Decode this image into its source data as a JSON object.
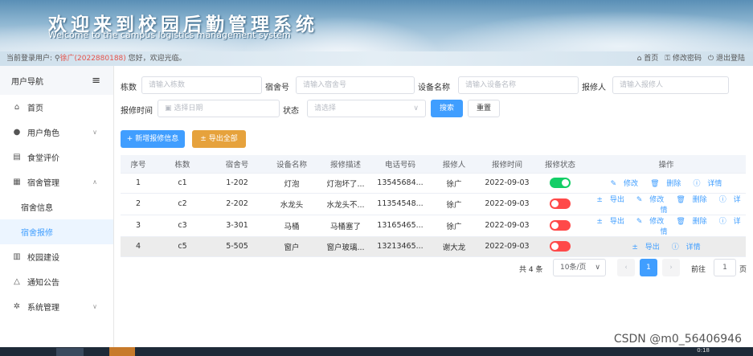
{
  "header": {
    "title_cn": "欢迎来到校园后勤管理系统",
    "title_en": "Welcome to the campus logistics management system"
  },
  "infobar": {
    "prefix": "当前登录用户: ",
    "user": "徐广(2022880188)",
    "greeting": " 您好，欢迎光临。",
    "links": [
      "首页",
      "修改密码",
      "退出登陆"
    ]
  },
  "sidebar": {
    "title": "用户导航",
    "items": [
      {
        "label": "首页",
        "icon": "home-icon"
      },
      {
        "label": "用户角色",
        "icon": "user-icon"
      },
      {
        "label": "食堂评价",
        "icon": "document-icon"
      },
      {
        "label": "宿舍管理",
        "icon": "building-icon"
      },
      {
        "label": "宿舍信息"
      },
      {
        "label": "宿舍报修"
      },
      {
        "label": "校园建设",
        "icon": "building-icon"
      },
      {
        "label": "通知公告",
        "icon": "bell-icon"
      },
      {
        "label": "系统管理",
        "icon": "gear-icon"
      }
    ]
  },
  "search": {
    "building_label": "栋数",
    "building_ph": "请输入栋数",
    "room_label": "宿舍号",
    "room_ph": "请输入宿舍号",
    "device_label": "设备名称",
    "device_ph": "请输入设备名称",
    "reporter_label": "报修人",
    "reporter_ph": "请输入报修人",
    "time_label": "报修时间",
    "time_ph": "选择日期",
    "status_label": "状态",
    "status_ph": "请选择",
    "search_btn": "搜索",
    "reset_btn": "重置"
  },
  "actions": {
    "add": "+ 新增报修信息",
    "export_all": "± 导出全部"
  },
  "table": {
    "headers": [
      "序号",
      "栋数",
      "宿舍号",
      "设备名称",
      "报修描述",
      "电话号码",
      "报修人",
      "报修时间",
      "报修状态",
      "操作"
    ],
    "rows": [
      {
        "no": "1",
        "building": "c1",
        "room": "1-202",
        "device": "灯泡",
        "desc": "灯泡坏了...",
        "phone": "13545684...",
        "reporter": "徐广",
        "time": "2022-09-03",
        "status": true,
        "ops": [
          "修改",
          "删除",
          "详情"
        ]
      },
      {
        "no": "2",
        "building": "c2",
        "room": "2-202",
        "device": "水龙头",
        "desc": "水龙头不...",
        "phone": "11354548...",
        "reporter": "徐广",
        "time": "2022-09-03",
        "status": false,
        "ops": [
          "导出",
          "修改",
          "删除",
          "详情"
        ]
      },
      {
        "no": "3",
        "building": "c3",
        "room": "3-301",
        "device": "马桶",
        "desc": "马桶塞了",
        "phone": "13165465...",
        "reporter": "徐广",
        "time": "2022-09-03",
        "status": false,
        "ops": [
          "导出",
          "修改",
          "删除",
          "详情"
        ]
      },
      {
        "no": "4",
        "building": "c5",
        "room": "5-505",
        "device": "窗户",
        "desc": "窗户玻璃...",
        "phone": "13213465...",
        "reporter": "谢大龙",
        "time": "2022-09-03",
        "status": false,
        "ops": [
          "导出",
          "详情"
        ]
      }
    ]
  },
  "pagination": {
    "total": "共 4 条",
    "size": "10条/页",
    "page": "1",
    "goto": "前往",
    "goto_val": "1",
    "page_unit": "页"
  },
  "watermark": "CSDN @m0_56406946",
  "clock": "0:18",
  "colors": {
    "primary": "#409eff",
    "success": "#13ce66",
    "danger": "#ff4949",
    "warning": "#e6a23c"
  }
}
